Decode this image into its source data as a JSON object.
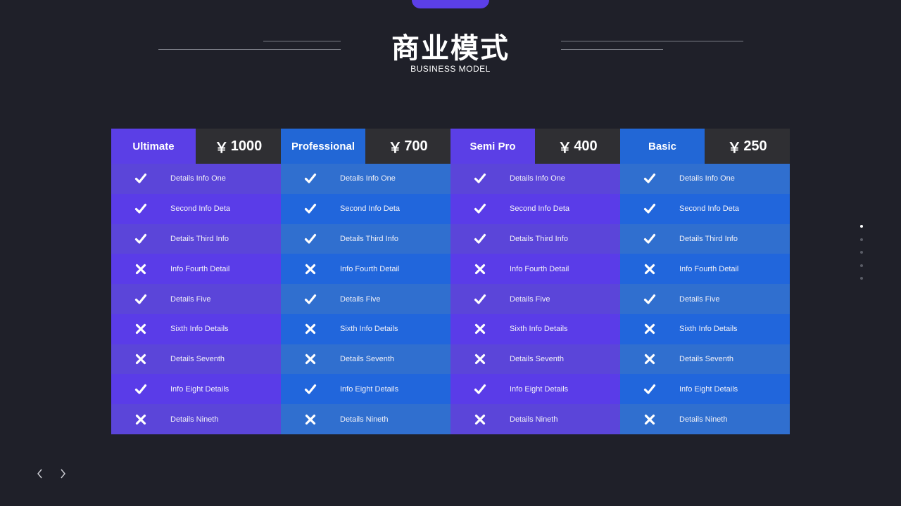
{
  "header": {
    "title": "商业模式",
    "subtitle": "BUSINESS MODEL"
  },
  "colors": {
    "background": "#1f2029",
    "purple": "#5b3fe6",
    "blue": "#2267d6",
    "price_bg": "#2f2f33",
    "accent_tab": "#5b3fe6"
  },
  "plans": [
    {
      "name": "Ultimate",
      "currency": "￥",
      "price": "1000",
      "theme": "purple",
      "rows": [
        {
          "mark": "check",
          "text": "Details  Info One"
        },
        {
          "mark": "check",
          "text": "Second Info Deta"
        },
        {
          "mark": "check",
          "text": "Details  Third Info"
        },
        {
          "mark": "cross",
          "text": "Info Fourth Detail"
        },
        {
          "mark": "check",
          "text": "Details  Five"
        },
        {
          "mark": "cross",
          "text": "Sixth Info Details"
        },
        {
          "mark": "cross",
          "text": "Details  Seventh"
        },
        {
          "mark": "check",
          "text": "Info Eight Details"
        },
        {
          "mark": "cross",
          "text": "Details  Nineth"
        }
      ]
    },
    {
      "name": "Professional",
      "currency": "￥",
      "price": "700",
      "theme": "blue",
      "rows": [
        {
          "mark": "check",
          "text": "Details  Info One"
        },
        {
          "mark": "check",
          "text": "Second Info Deta"
        },
        {
          "mark": "check",
          "text": "Details  Third Info"
        },
        {
          "mark": "cross",
          "text": "Info Fourth Detail"
        },
        {
          "mark": "check",
          "text": "Details  Five"
        },
        {
          "mark": "cross",
          "text": "Sixth Info Details"
        },
        {
          "mark": "cross",
          "text": "Details  Seventh"
        },
        {
          "mark": "check",
          "text": "Info Eight Details"
        },
        {
          "mark": "cross",
          "text": "Details  Nineth"
        }
      ]
    },
    {
      "name": "Semi Pro",
      "currency": "￥",
      "price": "400",
      "theme": "purple",
      "rows": [
        {
          "mark": "check",
          "text": "Details  Info One"
        },
        {
          "mark": "check",
          "text": "Second Info Deta"
        },
        {
          "mark": "check",
          "text": "Details  Third Info"
        },
        {
          "mark": "cross",
          "text": "Info Fourth Detail"
        },
        {
          "mark": "check",
          "text": "Details  Five"
        },
        {
          "mark": "cross",
          "text": "Sixth Info Details"
        },
        {
          "mark": "cross",
          "text": "Details  Seventh"
        },
        {
          "mark": "check",
          "text": "Info Eight Details"
        },
        {
          "mark": "cross",
          "text": "Details  Nineth"
        }
      ]
    },
    {
      "name": "Basic",
      "currency": "￥",
      "price": "250",
      "theme": "blue",
      "rows": [
        {
          "mark": "check",
          "text": "Details  Info One"
        },
        {
          "mark": "check",
          "text": "Second Info Deta"
        },
        {
          "mark": "check",
          "text": "Details  Third Info"
        },
        {
          "mark": "cross",
          "text": "Info Fourth Detail"
        },
        {
          "mark": "check",
          "text": "Details  Five"
        },
        {
          "mark": "cross",
          "text": "Sixth Info Details"
        },
        {
          "mark": "cross",
          "text": "Details  Seventh"
        },
        {
          "mark": "check",
          "text": "Info Eight Details"
        },
        {
          "mark": "cross",
          "text": "Details  Nineth"
        }
      ]
    }
  ],
  "pagination": {
    "active_index": 0,
    "page_count": 5
  },
  "navigation": {
    "prev_icon": "chevron-left-icon",
    "next_icon": "chevron-right-icon"
  }
}
